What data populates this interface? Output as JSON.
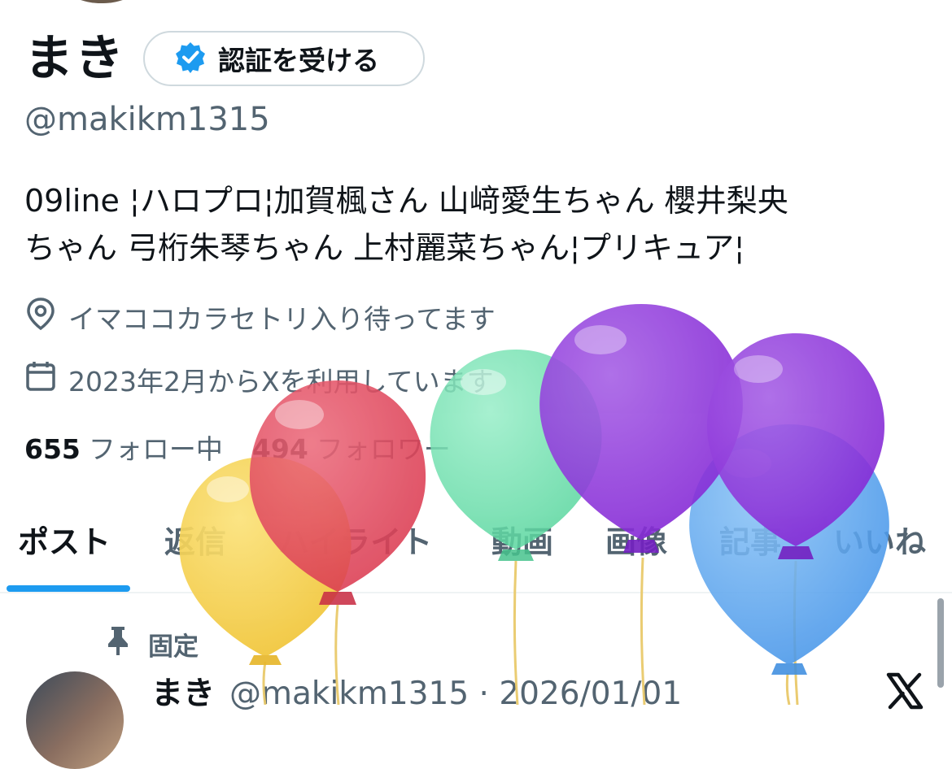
{
  "profile": {
    "name": "まき",
    "verify_label": "認証を受ける",
    "handle": "@makikm1315",
    "bio_line1": "09line ¦ハロプロ¦加賀楓さん 山﨑愛生ちゃん 櫻井梨央",
    "bio_line2": "ちゃん 弓桁朱琴ちゃん 上村麗菜ちゃん¦プリキュア¦",
    "location": "イマココカラセトリ入り待ってます",
    "joined": "2023年2月からXを利用しています",
    "following_count": "655",
    "following_label": "フォロー中",
    "followers_count": "494",
    "followers_label": "フォロワー"
  },
  "tabs": [
    {
      "label": "ポスト"
    },
    {
      "label": "返信"
    },
    {
      "label": "ハイライト"
    },
    {
      "label": "動画"
    },
    {
      "label": "画像"
    },
    {
      "label": "記事"
    },
    {
      "label": "いいね"
    }
  ],
  "pinned_post": {
    "pinned_label": "固定",
    "author_name": "まき",
    "handle_date": "@makikm1315 · 2026/01/01"
  },
  "icons": {
    "verified": "verified-badge-icon",
    "location": "location-pin-icon",
    "calendar": "calendar-icon",
    "pin": "pin-icon",
    "x_logo": "x-logo-icon"
  },
  "colors": {
    "accent": "#1d9bf0",
    "secondary_text": "#536471",
    "balloon_yellow": "#f5cf45",
    "balloon_red": "#e0455a",
    "balloon_green": "#6ee0ad",
    "balloon_purple": "#8e35dc",
    "balloon_blue": "#55a3ee"
  }
}
